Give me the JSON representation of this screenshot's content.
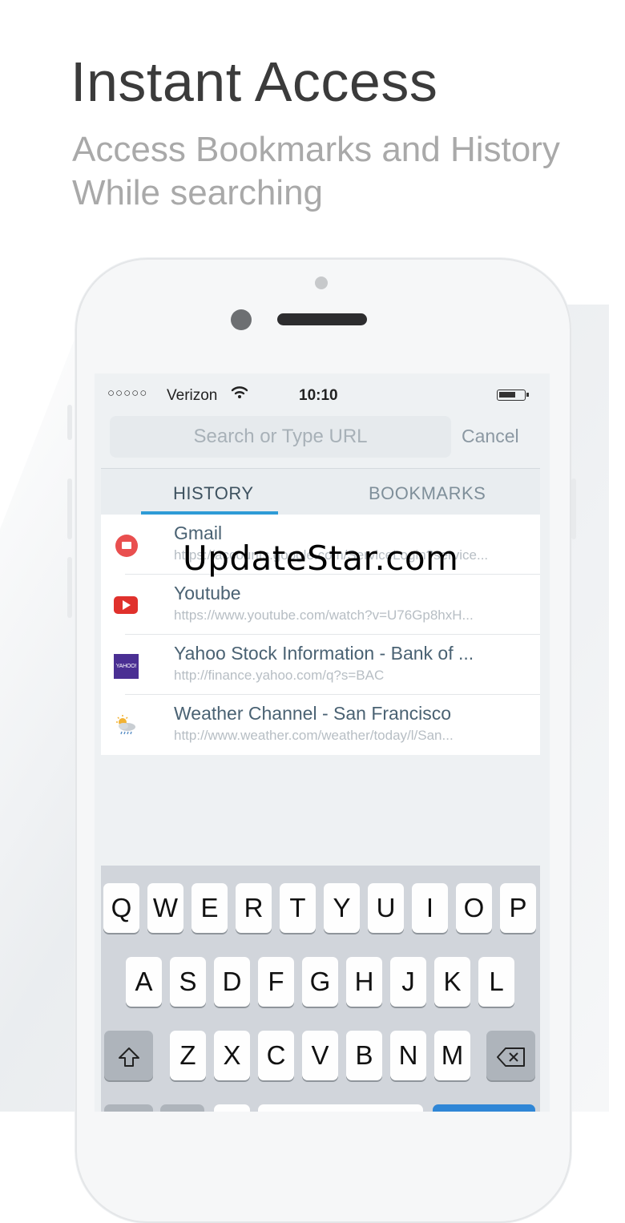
{
  "header": {
    "headline": "Instant Access",
    "subtitle_line1": "Access Bookmarks and History",
    "subtitle_line2": "While searching"
  },
  "status_bar": {
    "signal": "○○○○○",
    "carrier": "Verizon",
    "time": "10:10"
  },
  "search": {
    "placeholder": "Search or Type URL",
    "cancel_label": "Cancel"
  },
  "tabs": {
    "history": "HISTORY",
    "bookmarks": "BOOKMARKS",
    "active": "history",
    "accent_color": "#2e9bd6"
  },
  "history": [
    {
      "icon": "gmail-icon",
      "title": "Gmail",
      "url": "https://accounts.google.com/ServiceLogin?service..."
    },
    {
      "icon": "youtube-icon",
      "title": "Youtube",
      "url": "https://www.youtube.com/watch?v=U76Gp8hxH..."
    },
    {
      "icon": "yahoo-icon",
      "icon_text": "YAHOO!",
      "title": "Yahoo Stock Information - Bank of ...",
      "url": "http://finance.yahoo.com/q?s=BAC"
    },
    {
      "icon": "weather-icon",
      "title": "Weather Channel - San Francisco",
      "url": "http://www.weather.com/weather/today/l/San..."
    }
  ],
  "keyboard": {
    "row1": [
      "Q",
      "W",
      "E",
      "R",
      "T",
      "Y",
      "U",
      "I",
      "O",
      "P"
    ],
    "row2": [
      "A",
      "S",
      "D",
      "F",
      "G",
      "H",
      "J",
      "K",
      "L"
    ],
    "row3": [
      "Z",
      "X",
      "C",
      "V",
      "B",
      "N",
      "M"
    ],
    "shift_icon": "shift-icon",
    "backspace_icon": "backspace-icon"
  },
  "watermark": "UpdateStar.com"
}
